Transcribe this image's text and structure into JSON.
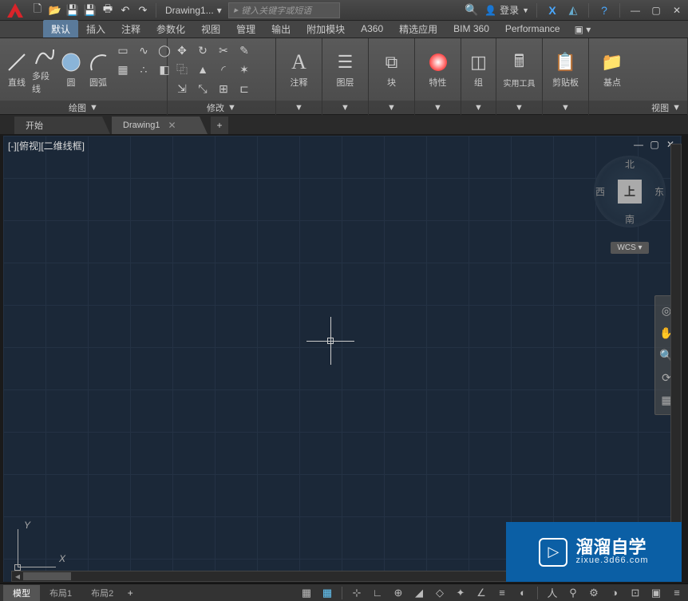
{
  "titlebar": {
    "doc_title": "Drawing1...",
    "search_placeholder": "键入关键字或短语",
    "signin_label": "登录"
  },
  "ribbon_tabs": [
    "默认",
    "插入",
    "注释",
    "参数化",
    "视图",
    "管理",
    "输出",
    "附加模块",
    "A360",
    "精选应用",
    "BIM 360",
    "Performance"
  ],
  "active_ribbon_tab": 0,
  "ribbon": {
    "draw": {
      "label": "绘图",
      "tools": [
        {
          "name": "line",
          "label": "直线"
        },
        {
          "name": "polyline",
          "label": "多段线"
        },
        {
          "name": "circle",
          "label": "圆"
        },
        {
          "name": "arc",
          "label": "圆弧"
        }
      ]
    },
    "modify": {
      "label": "修改"
    },
    "annotate": {
      "label": "注释",
      "tool": "注释"
    },
    "layer": {
      "label": "图层",
      "tool": "图层"
    },
    "block": {
      "label": "块",
      "tool": "块"
    },
    "property": {
      "label": "特性",
      "tool": "特性"
    },
    "group": {
      "label": "组",
      "tool": "组"
    },
    "util": {
      "label": "实用工具",
      "tool": "实用工具"
    },
    "clipboard": {
      "label": "剪贴板",
      "tool": "剪贴板"
    },
    "base": {
      "label": "视图",
      "tool": "基点"
    }
  },
  "file_tabs": [
    {
      "label": "开始",
      "active": false,
      "closable": false
    },
    {
      "label": "Drawing1",
      "active": true,
      "closable": true
    }
  ],
  "viewport_label": "[-][俯视][二维线框]",
  "viewcube": {
    "top": "上",
    "n": "北",
    "s": "南",
    "e": "东",
    "w": "西",
    "wcs": "WCS"
  },
  "ucs": {
    "x": "X",
    "y": "Y"
  },
  "layout_tabs": [
    "模型",
    "布局1",
    "布局2"
  ],
  "active_layout": 0,
  "watermark": {
    "brand": "溜溜自学",
    "url": "zixue.3d66.com"
  }
}
